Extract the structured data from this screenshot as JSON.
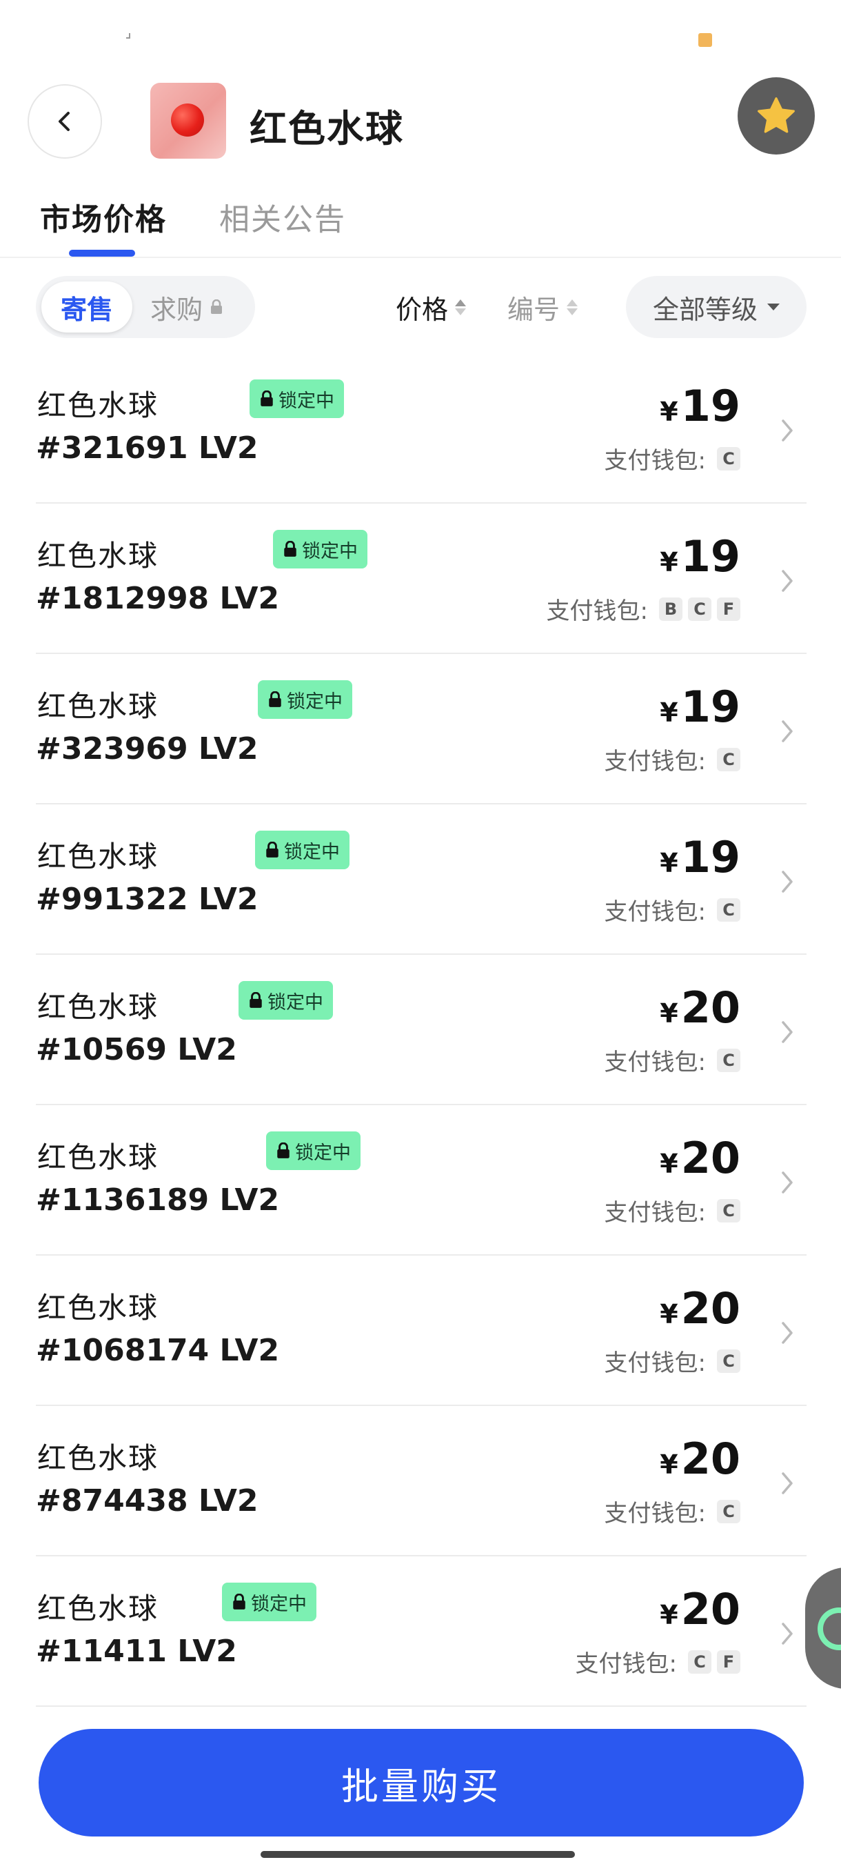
{
  "header": {
    "title": "红色水球"
  },
  "tabs": [
    {
      "label": "市场价格",
      "active": true
    },
    {
      "label": "相关公告",
      "active": false
    }
  ],
  "filters": {
    "segment_on": "寄售",
    "segment_off": "求购",
    "sort_price": "价格",
    "sort_number": "编号",
    "level": "全部等级"
  },
  "listings": [
    {
      "name": "红色水球",
      "serial": "#321691 LV2",
      "locked": true,
      "lock_label": "锁定中",
      "currency": "¥",
      "price": "19",
      "wallet_label": "支付钱包:",
      "wallets": [
        "C"
      ]
    },
    {
      "name": "红色水球",
      "serial": "#1812998 LV2",
      "locked": true,
      "lock_label": "锁定中",
      "currency": "¥",
      "price": "19",
      "wallet_label": "支付钱包:",
      "wallets": [
        "B",
        "C",
        "F"
      ]
    },
    {
      "name": "红色水球",
      "serial": "#323969 LV2",
      "locked": true,
      "lock_label": "锁定中",
      "currency": "¥",
      "price": "19",
      "wallet_label": "支付钱包:",
      "wallets": [
        "C"
      ]
    },
    {
      "name": "红色水球",
      "serial": "#991322 LV2",
      "locked": true,
      "lock_label": "锁定中",
      "currency": "¥",
      "price": "19",
      "wallet_label": "支付钱包:",
      "wallets": [
        "C"
      ]
    },
    {
      "name": "红色水球",
      "serial": "#10569 LV2",
      "locked": true,
      "lock_label": "锁定中",
      "currency": "¥",
      "price": "20",
      "wallet_label": "支付钱包:",
      "wallets": [
        "C"
      ]
    },
    {
      "name": "红色水球",
      "serial": "#1136189 LV2",
      "locked": true,
      "lock_label": "锁定中",
      "currency": "¥",
      "price": "20",
      "wallet_label": "支付钱包:",
      "wallets": [
        "C"
      ]
    },
    {
      "name": "红色水球",
      "serial": "#1068174 LV2",
      "locked": false,
      "lock_label": "",
      "currency": "¥",
      "price": "20",
      "wallet_label": "支付钱包:",
      "wallets": [
        "C"
      ]
    },
    {
      "name": "红色水球",
      "serial": "#874438 LV2",
      "locked": false,
      "lock_label": "",
      "currency": "¥",
      "price": "20",
      "wallet_label": "支付钱包:",
      "wallets": [
        "C"
      ]
    },
    {
      "name": "红色水球",
      "serial": "#11411 LV2",
      "locked": true,
      "lock_label": "锁定中",
      "currency": "¥",
      "price": "20",
      "wallet_label": "支付钱包:",
      "wallets": [
        "C",
        "F"
      ]
    }
  ],
  "footer": {
    "buy_label": "批量购买"
  },
  "colors": {
    "accent": "#2b58f0",
    "lock_badge": "#7cf0b2",
    "favorite": "#f5c242"
  }
}
